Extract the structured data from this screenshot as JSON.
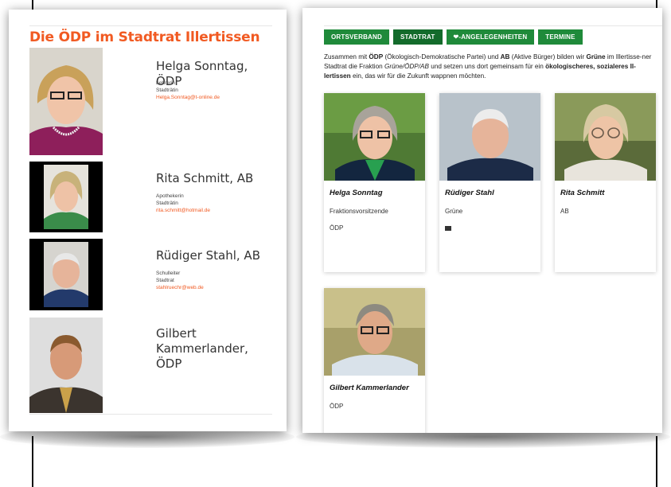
{
  "left": {
    "title": "Die ÖDP im Stadtrat Illertissen",
    "people": [
      {
        "name": "Helga Sonntag, ÖDP",
        "job": "Lehrerin",
        "office": "Stadträtin",
        "email": "Helga.Sonntag@t-online.de"
      },
      {
        "name": "Rita Schmitt, AB",
        "job": "Apothekerin",
        "office": "Stadträtin",
        "email": "rita.schmitt@hotmail.de"
      },
      {
        "name": "Rüdiger Stahl, AB",
        "job": "Schulleiter",
        "office": "Stadtrat",
        "email": "stahlruechr@web.de"
      },
      {
        "name": "Gilbert Kammerlander, ÖDP",
        "job": "",
        "office": "",
        "email": ""
      }
    ]
  },
  "right": {
    "nav": [
      "ORTSVERBAND",
      "STADTRAT",
      "❤-ANGELEGENHEITEN",
      "TERMINE"
    ],
    "intro": {
      "p1": "Zusammen mit ",
      "b1": "ÖDP",
      "p2": " (Ökologisch-Demokratische Partei) und ",
      "b2": "AB",
      "p3": " (Aktive Bürger) bilden wir ",
      "b3": "Grüne",
      "p4": " im Illertisse-ner Stadtrat die Fraktion ",
      "i1": "Grüne/ÖDP/AB",
      "p5": " und setzen uns dort gemeinsam für ein ",
      "b4": "ökologischeres, sozialeres Il-lertissen",
      "p6": " ein, das wir für die Zukunft wappnen möchten."
    },
    "cards": [
      {
        "name": "Helga Sonntag",
        "role": "Fraktionsvorsitzende",
        "party": "ÖDP"
      },
      {
        "name": "Rüdiger Stahl",
        "role": "Grüne",
        "party": ""
      },
      {
        "name": "Rita Schmitt",
        "role": "AB",
        "party": ""
      },
      {
        "name": "Gilbert Kammerlander",
        "role": "ÖDP",
        "party": ""
      }
    ]
  },
  "colors": {
    "accent": "#f15a22",
    "nav_green": "#1f8a3a",
    "nav_active": "#136b2b"
  }
}
